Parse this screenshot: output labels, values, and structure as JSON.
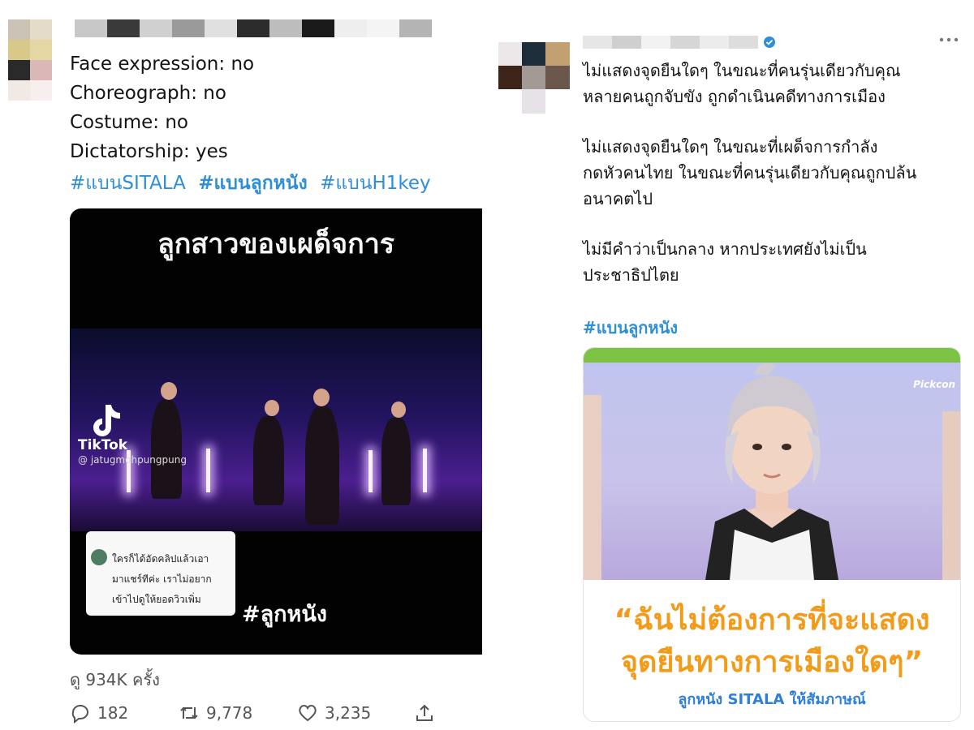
{
  "left_tweet": {
    "lines": [
      "Face expression: no",
      "Choreograph: no",
      "Costume: no",
      "Dictatorship: yes"
    ],
    "hashtags": [
      "#แบนSITALA",
      "#แบนลูกหนัง",
      "#แบนH1key"
    ],
    "video": {
      "title": "ลูกสาวของเผด็จการ",
      "tiktok_label": "TikTok",
      "tiktok_handle": "@ jatugmohpungpung",
      "comment_lines": [
        "ใครก็ได้อัดคลิปแล้วเอา",
        "มาแชร์ทีค่ะ เราไม่อยาก",
        "เข้าไปดูให้ยอดวิวเพิ่ม"
      ],
      "hashtag": "#ลูกหนัง"
    },
    "views": "ดู 934K ครั้ง",
    "actions": {
      "replies": "182",
      "retweets": "9,778",
      "likes": "3,235"
    }
  },
  "right_tweet": {
    "paragraphs": [
      [
        "ไม่แสดงจุดยืนใดๆ ในขณะที่คนรุ่นเดียวกับคุณ",
        "หลายคนถูกจับขัง ถูกดำเนินคดีทางการเมือง"
      ],
      [
        "ไม่แสดงจุดยืนใดๆ ในขณะที่เผด็จการกำลัง",
        "กดหัวคนไทย ในขณะที่คนรุ่นเดียวกับคุณถูกปล้น",
        "อนาคตไป"
      ],
      [
        "ไม่มีคำว่าเป็นกลาง หากประเทศยังไม่เป็น",
        "ประชาธิปไตย"
      ]
    ],
    "hashtag": "#แบนลูกหนัง",
    "card": {
      "brand": "Pickcon",
      "quote_line_1": "“ฉันไม่ต้องการที่จะแสดง",
      "quote_line_2": "จุดยืนทางการเมืองใดๆ”",
      "credit": "ลูกหนัง SITALA ให้สัมภาษณ์"
    }
  },
  "colors": {
    "link_blue": "#2f8fd6",
    "quote_orange": "#f39b19",
    "credit_blue": "#2f7ed8",
    "card_green": "#7cc243"
  },
  "icons": [
    "reply-icon",
    "retweet-icon",
    "like-icon",
    "share-icon",
    "more-icon",
    "verified-icon",
    "tiktok-logo-icon"
  ]
}
